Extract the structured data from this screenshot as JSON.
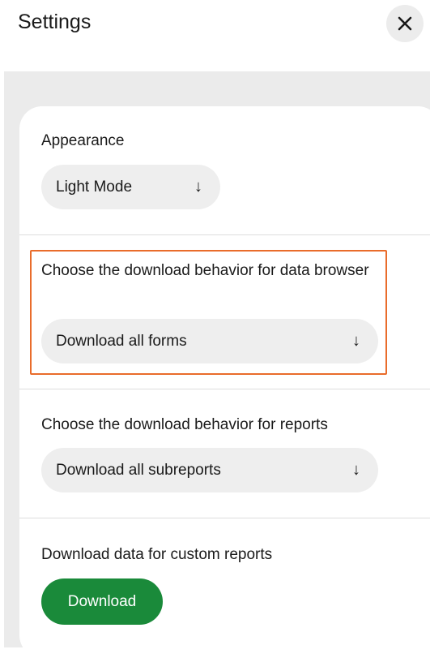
{
  "header": {
    "title": "Settings",
    "close_icon": "close-icon"
  },
  "appearance": {
    "label": "Appearance",
    "selected": "Light Mode",
    "arrow": "↓"
  },
  "data_browser": {
    "label": "Choose the download behavior for data browser",
    "selected": "Download all forms",
    "arrow": "↓"
  },
  "reports": {
    "label": "Choose the download behavior for reports",
    "selected": "Download all subreports",
    "arrow": "↓"
  },
  "custom_reports": {
    "label": "Download data for custom reports",
    "button_label": "Download"
  },
  "colors": {
    "accent_green": "#1a8a3a",
    "highlight_orange": "#e96c2b",
    "panel_gray": "#ebebeb",
    "dropdown_gray": "#eeeeee"
  }
}
